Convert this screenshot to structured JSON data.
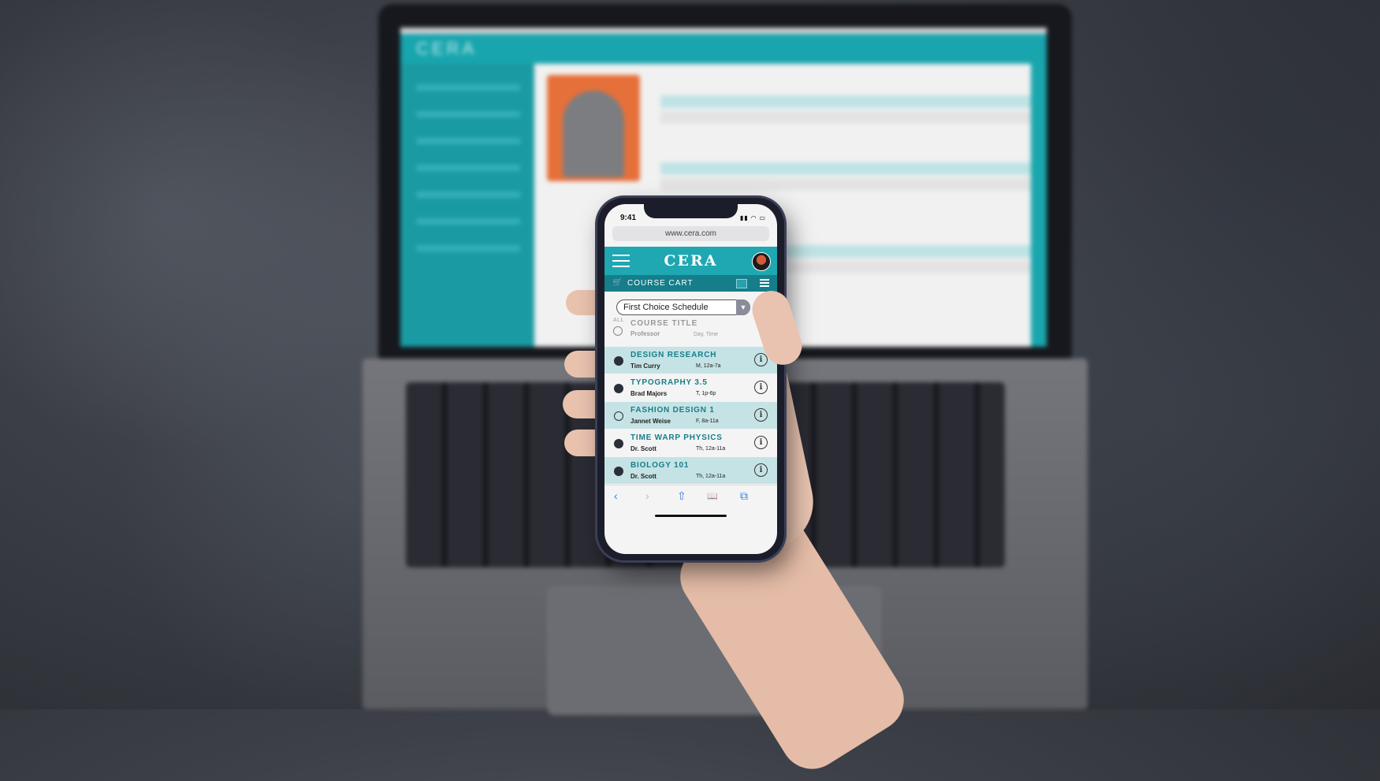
{
  "status": {
    "time": "9:41",
    "signal": "▮▮ ◠ ▭"
  },
  "browser": {
    "url": "www.cera.com"
  },
  "app": {
    "brand": "CERA",
    "cart_title": "COURSE CART"
  },
  "schedule_select": {
    "value": "First Choice Schedule",
    "arrow": "▼"
  },
  "list_header": {
    "all": "ALL",
    "title": "COURSE TITLE",
    "professor": "Professor",
    "day_time": "Day, Time"
  },
  "courses": [
    {
      "name": "DESIGN RESEARCH",
      "professor": "Tim Curry",
      "day_time": "M, 12a-7a",
      "selected": true
    },
    {
      "name": "TYPOGRAPHY 3.5",
      "professor": "Brad Majors",
      "day_time": "T, 1p-6p",
      "selected": true
    },
    {
      "name": "FASHION DESIGN 1",
      "professor": "Jannet Weise",
      "day_time": "F, 8a-11a",
      "selected": false
    },
    {
      "name": "TIME WARP PHYSICS",
      "professor": "Dr. Scott",
      "day_time": "Th, 12a-11a",
      "selected": true
    },
    {
      "name": "BIOLOGY 101",
      "professor": "Dr. Scott",
      "day_time": "Th, 12a-11a",
      "selected": true
    }
  ],
  "info_glyph": "i",
  "toolbar": {
    "back": "‹",
    "forward": "›",
    "share": "⇧",
    "bookmarks": "📖",
    "tabs": "⧉"
  },
  "icons": {
    "cart": "🛒"
  },
  "colors": {
    "brand": "#1fa7b2",
    "cart_bar": "#157e8a",
    "row_highlight": "#c5e3e5"
  }
}
